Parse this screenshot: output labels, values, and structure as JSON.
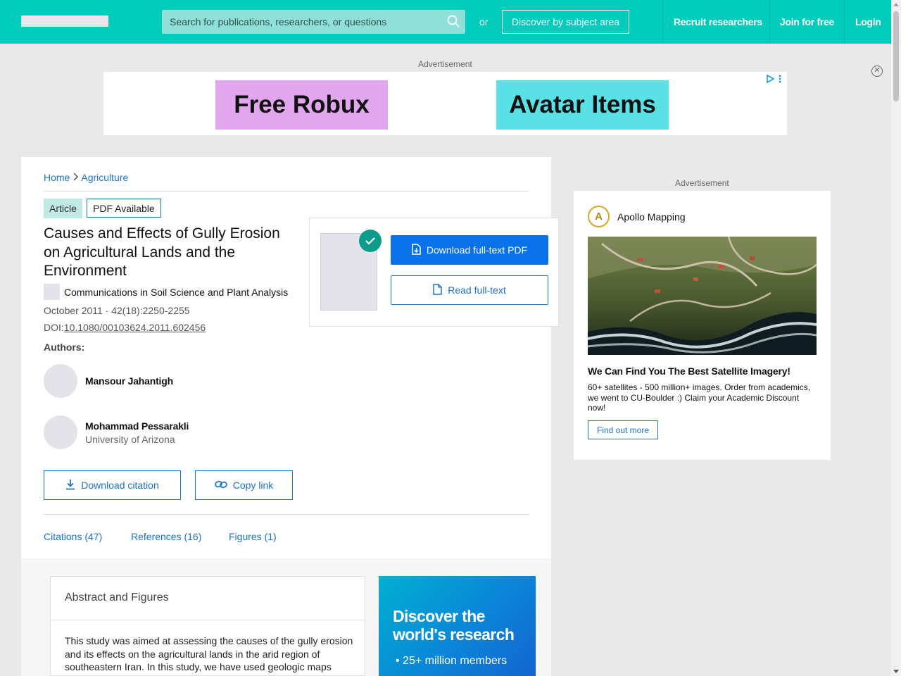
{
  "header": {
    "search_placeholder": "Search for publications, researchers, or questions",
    "or_text": "or",
    "discover_label": "Discover by subject area",
    "nav": [
      "Recruit researchers",
      "Join for free",
      "Login"
    ],
    "brand_color": "#00ccbb"
  },
  "top_ad": {
    "label": "Advertisement",
    "tile1": "Free Robux",
    "tile2": "Avatar Items",
    "close_glyph": "✕"
  },
  "breadcrumb": {
    "home": "Home",
    "category": "Agriculture"
  },
  "badges": {
    "article": "Article",
    "pdf": "PDF Available"
  },
  "publication": {
    "title": "Causes and Effects of Gully Erosion on Agricultural Lands and the Environment",
    "journal": "Communications in Soil Science and Plant Analysis",
    "meta": "October 2011 · 42(18):2250-2255",
    "doi_prefix": "DOI:",
    "doi": "10.1080/00103624.2011.602456",
    "authors_label": "Authors:",
    "authors": [
      {
        "name": "Mansour Jahantigh",
        "affiliation": ""
      },
      {
        "name": "Mohammad Pessarakli",
        "affiliation": "University of Arizona"
      }
    ]
  },
  "actions": {
    "download_citation": "Download citation",
    "copy_link": "Copy link",
    "download_pdf": "Download full-text PDF",
    "read_fulltext": "Read full-text"
  },
  "tabs": [
    "Citations (47)",
    "References (16)",
    "Figures (1)"
  ],
  "side_ad": {
    "label": "Advertisement",
    "brand": "Apollo Mapping",
    "logo_glyph": "A",
    "headline": "We Can Find You The Best Satellite Imagery!",
    "body": "60+ satellites - 500 million+ images. Order from academics, we went to CU-Boulder :) Claim your Academic Discount now!",
    "cta": "Find out more"
  },
  "abstract": {
    "title": "Abstract and Figures",
    "text": "This study was aimed at assessing the causes of the gully erosion and its effects on the agricultural lands in the arid region of southeastern Iran. In this study, we have used geologic maps"
  },
  "promo": {
    "title": "Discover the world's research",
    "bullet": "25+ million members"
  },
  "icons": {
    "search": "search-icon",
    "download": "download-icon",
    "link": "link-icon",
    "pdf": "pdf-file-icon",
    "file": "file-icon",
    "check": "check-icon",
    "close": "close-icon",
    "chevron": "chevron-right-icon"
  }
}
